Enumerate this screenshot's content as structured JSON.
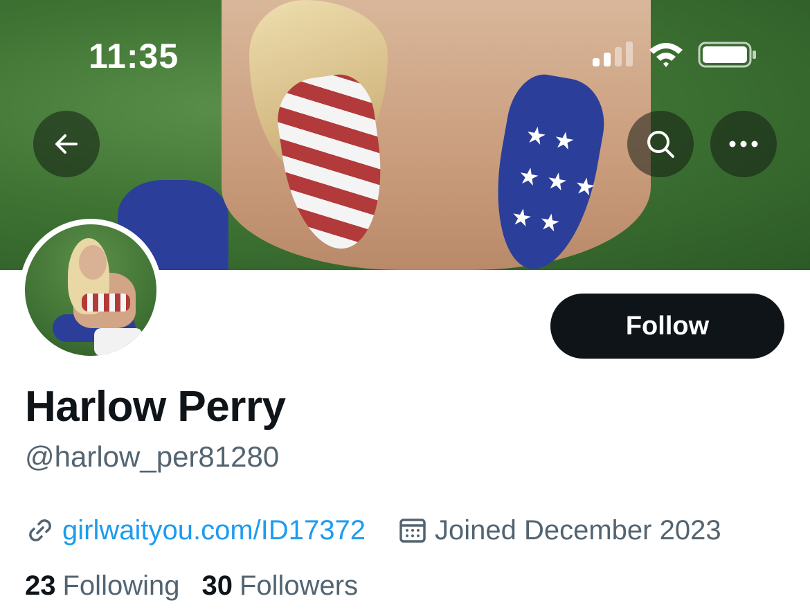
{
  "status_bar": {
    "time": "11:35",
    "icons": [
      "cellular-signal-icon",
      "wifi-icon",
      "battery-icon"
    ]
  },
  "header_actions": {
    "back_icon": "arrow-left-icon",
    "search_icon": "search-icon",
    "more_icon": "more-horizontal-icon"
  },
  "profile": {
    "display_name": "Harlow Perry",
    "handle": "@harlow_per81280",
    "follow_label": "Follow",
    "website": "girlwaityou.com/ID17372",
    "joined": "Joined December 2023",
    "following_count": "23",
    "following_label": "Following",
    "followers_count": "30",
    "followers_label": "Followers"
  },
  "colors": {
    "primary_text": "#0f1419",
    "secondary_text": "#536471",
    "link": "#1d9bf0",
    "button_bg": "#0f1419",
    "button_text": "#ffffff"
  }
}
